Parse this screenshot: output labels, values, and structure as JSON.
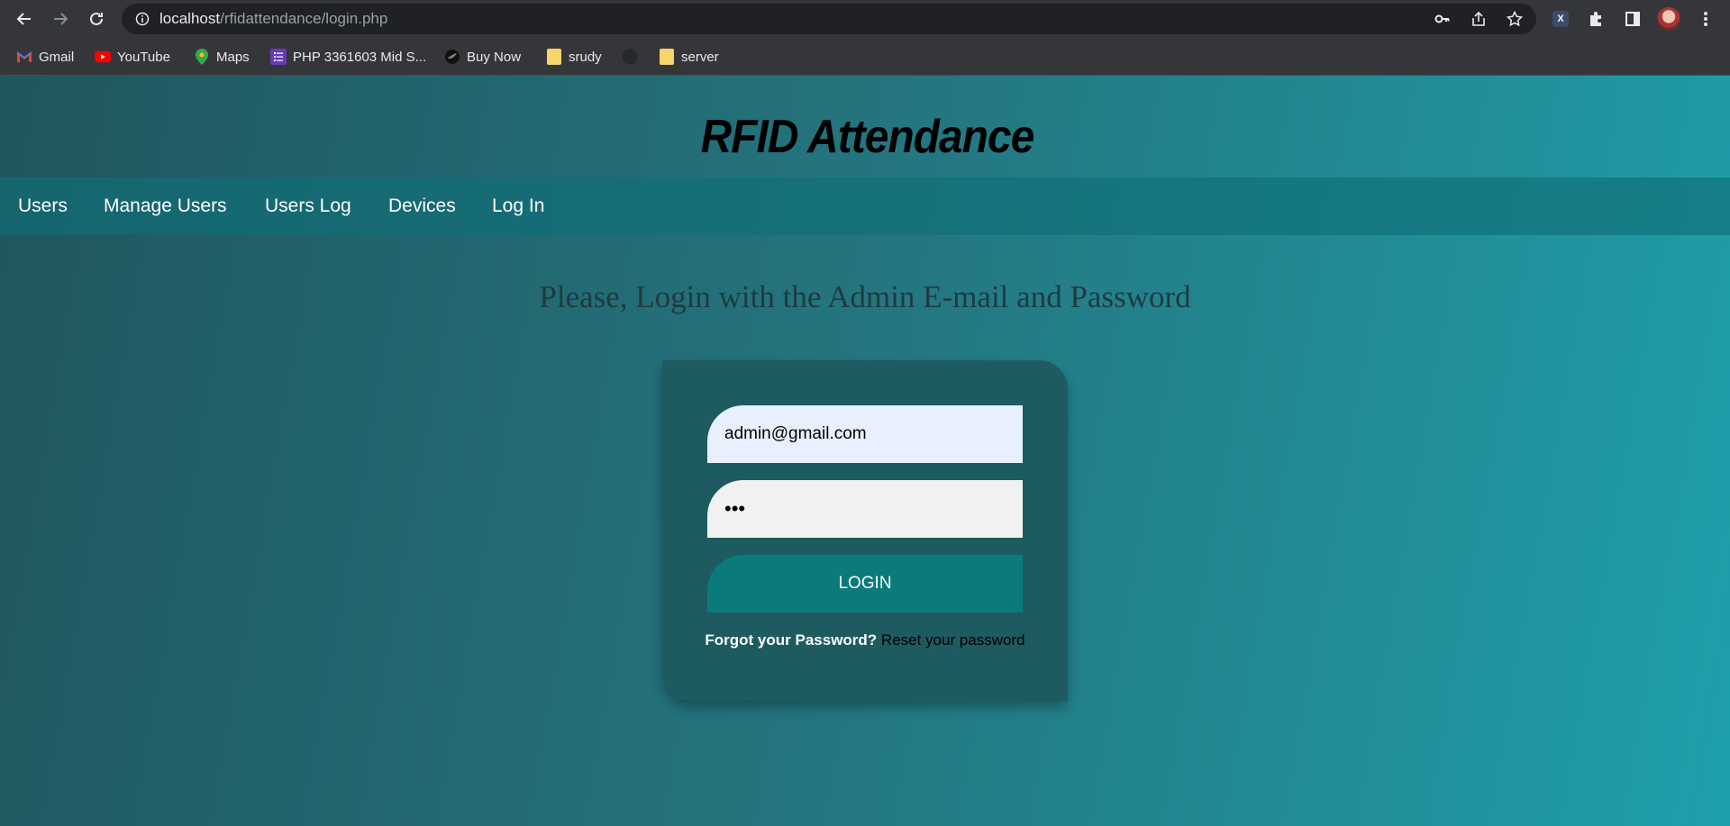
{
  "browser": {
    "url_host": "localhost",
    "url_path": "/rfidattendance/login.php",
    "bookmarks": [
      {
        "label": "Gmail",
        "icon": "gmail-icon"
      },
      {
        "label": "YouTube",
        "icon": "youtube-icon"
      },
      {
        "label": "Maps",
        "icon": "maps-icon"
      },
      {
        "label": "PHP 3361603 Mid S...",
        "icon": "forms-icon"
      },
      {
        "label": "Buy Now",
        "icon": "bird-icon"
      },
      {
        "label": "srudy",
        "icon": "folder-icon"
      },
      {
        "label": "",
        "icon": "github-icon"
      },
      {
        "label": "server",
        "icon": "folder-icon"
      }
    ]
  },
  "site": {
    "title": "RFID Attendance",
    "nav": [
      "Users",
      "Manage Users",
      "Users Log",
      "Devices",
      "Log In"
    ]
  },
  "login": {
    "heading": "Please, Login with the Admin E-mail and Password",
    "email_value": "admin@gmail.com",
    "password_value": "•••",
    "button_label": "LOGIN",
    "forgot_text": "Forgot your Password?",
    "reset_link": "Reset your password"
  },
  "colors": {
    "gradient_start": "#21555d",
    "gradient_end": "#1fa0ab",
    "card": "#1e5b60",
    "button": "#0a7a7a"
  }
}
